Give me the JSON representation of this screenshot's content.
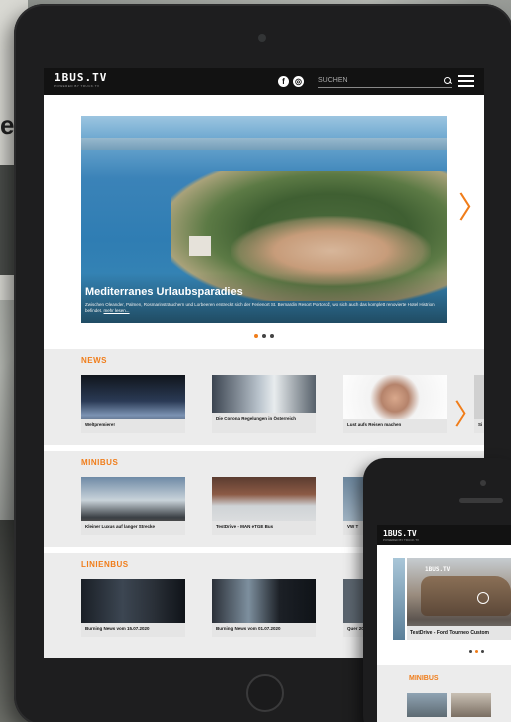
{
  "site": {
    "logo": "1BUS.TV",
    "logo_sub": "POWERED BY TRUCK.TV",
    "search_placeholder": "SUCHEN",
    "social": [
      "f",
      "◎"
    ]
  },
  "hero": {
    "title": "Mediterranes Urlaubsparadies",
    "description": "Zwischen Oleander, Palmen, Rosmarinsträuchern und Lorbeeren erstreckt sich der Ferienort St. Bernardin Resort Portorož, wo sich auch das komplett renovierte Hotel Histrion befindet.",
    "read_more": "mehr lesen..."
  },
  "background": {
    "edge_glyph": "e"
  },
  "sections": {
    "news": {
      "title": "NEWS",
      "cards": [
        "Weltpremiere!",
        "Die Corona Regelungen in Österreich",
        "Lust aufs Reisen machen",
        "Si"
      ]
    },
    "minibus": {
      "title": "MINIBUS",
      "cards": [
        "Kleiner Luxus auf langer Strecke",
        "TestDrive - MAN eTGE Bus",
        "VW T"
      ]
    },
    "linienbus": {
      "title": "LINIENBUS",
      "cards": [
        "Burning News vom 15.07.2020",
        "Burning News vom 01.07.2020",
        "Quer 2020"
      ]
    }
  },
  "phone": {
    "logo": "1BUS.TV",
    "logo_sub": "POWERED BY TRUCK.TV",
    "hero_label": "TestDrive - Ford Tourneo Custom",
    "hero_brand": "1BUS.TV",
    "section_title": "MINIBUS"
  },
  "colors": {
    "accent": "#f07d1a",
    "header": "#121212",
    "section_bg": "#ececec"
  }
}
